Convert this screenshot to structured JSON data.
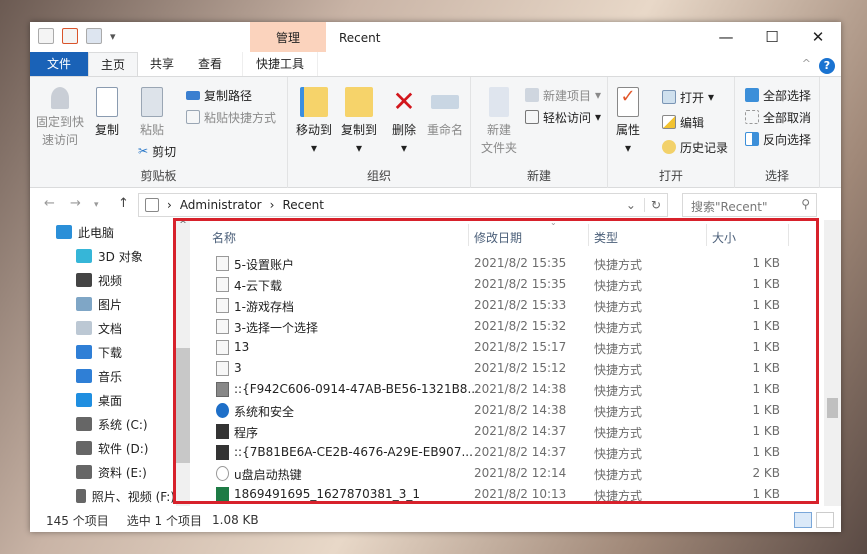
{
  "window": {
    "title": "Recent",
    "context_tab": "管理",
    "controls": {
      "minimize": "—",
      "maximize": "☐",
      "close": "✕"
    }
  },
  "tabs": [
    "文件",
    "主页",
    "共享",
    "查看",
    "快捷工具"
  ],
  "ribbon": {
    "clipboard": {
      "label": "剪贴板",
      "pin": "固定到快速访问",
      "pin_l1": "固定到快",
      "pin_l2": "速访问",
      "copy": "复制",
      "paste": "粘贴",
      "copy_path": "复制路径",
      "paste_shortcut": "粘贴快捷方式",
      "cut": "剪切"
    },
    "organize": {
      "label": "组织",
      "move_to": "移动到",
      "copy_to": "复制到",
      "delete": "删除",
      "rename": "重命名"
    },
    "new": {
      "label": "新建",
      "new_folder_l1": "新建",
      "new_folder_l2": "文件夹",
      "new_item": "新建项目",
      "easy_access": "轻松访问"
    },
    "open": {
      "label": "打开",
      "properties": "属性",
      "open": "打开",
      "edit": "编辑",
      "history": "历史记录"
    },
    "select": {
      "label": "选择",
      "select_all": "全部选择",
      "select_none": "全部取消",
      "invert": "反向选择"
    }
  },
  "address": {
    "crumbs": [
      "Administrator",
      "Recent"
    ],
    "search_placeholder": "搜索\"Recent\""
  },
  "sidebar": [
    {
      "label": "此电脑",
      "icon": "pc-icon",
      "color": "#2b8fd8"
    },
    {
      "label": "3D 对象",
      "icon": "3d-objects-icon",
      "color": "#36b6d8"
    },
    {
      "label": "视频",
      "icon": "video-icon",
      "color": "#444"
    },
    {
      "label": "图片",
      "icon": "pictures-icon",
      "color": "#7fa6c6"
    },
    {
      "label": "文档",
      "icon": "documents-icon",
      "color": "#bcc8d4"
    },
    {
      "label": "下载",
      "icon": "download-icon",
      "color": "#2f7fd6"
    },
    {
      "label": "音乐",
      "icon": "music-icon",
      "color": "#2f7fd6"
    },
    {
      "label": "桌面",
      "icon": "desktop-icon",
      "color": "#1f8ee0"
    },
    {
      "label": "系统 (C:)",
      "icon": "drive-c-icon",
      "color": "#666"
    },
    {
      "label": "软件 (D:)",
      "icon": "drive-icon",
      "color": "#666"
    },
    {
      "label": "资料 (E:)",
      "icon": "drive-icon",
      "color": "#666"
    },
    {
      "label": "照片、视频 (F:)",
      "icon": "drive-icon",
      "color": "#666"
    }
  ],
  "columns": {
    "name": "名称",
    "date": "修改日期",
    "type": "类型",
    "size": "大小"
  },
  "files": [
    {
      "name": "5-设置账户",
      "date": "2021/8/2 15:35",
      "type": "快捷方式",
      "size": "1 KB",
      "icon": "shortcut-icon"
    },
    {
      "name": "4-云下载",
      "date": "2021/8/2 15:35",
      "type": "快捷方式",
      "size": "1 KB",
      "icon": "shortcut-icon"
    },
    {
      "name": "1-游戏存档",
      "date": "2021/8/2 15:33",
      "type": "快捷方式",
      "size": "1 KB",
      "icon": "shortcut-icon"
    },
    {
      "name": "3-选择一个选择",
      "date": "2021/8/2 15:32",
      "type": "快捷方式",
      "size": "1 KB",
      "icon": "shortcut-icon"
    },
    {
      "name": "13",
      "date": "2021/8/2 15:17",
      "type": "快捷方式",
      "size": "1 KB",
      "icon": "shortcut-icon"
    },
    {
      "name": "3",
      "date": "2021/8/2 15:12",
      "type": "快捷方式",
      "size": "1 KB",
      "icon": "shortcut-icon"
    },
    {
      "name": "::{F942C606-0914-47AB-BE56-1321B8...",
      "date": "2021/8/2 14:38",
      "type": "快捷方式",
      "size": "1 KB",
      "icon": "storage-icon"
    },
    {
      "name": "系统和安全",
      "date": "2021/8/2 14:38",
      "type": "快捷方式",
      "size": "1 KB",
      "icon": "security-icon"
    },
    {
      "name": "程序",
      "date": "2021/8/2 14:37",
      "type": "快捷方式",
      "size": "1 KB",
      "icon": "programs-icon"
    },
    {
      "name": "::{7B81BE6A-CE2B-4676-A29E-EB907...",
      "date": "2021/8/2 14:37",
      "type": "快捷方式",
      "size": "1 KB",
      "icon": "programs-icon"
    },
    {
      "name": "u盘启动热键",
      "date": "2021/8/2 12:14",
      "type": "快捷方式",
      "size": "2 KB",
      "icon": "search-icon"
    },
    {
      "name": "1869491695_1627870381_3_1",
      "date": "2021/8/2 10:13",
      "type": "快捷方式",
      "size": "1 KB",
      "icon": "excel-icon"
    }
  ],
  "status": {
    "count": "145 个项目",
    "selected": "选中 1 个项目",
    "size": "1.08 KB"
  },
  "colors": {
    "accent": "#1a62b7",
    "context": "#fbd3bd",
    "highlight_box": "#d7212b"
  }
}
